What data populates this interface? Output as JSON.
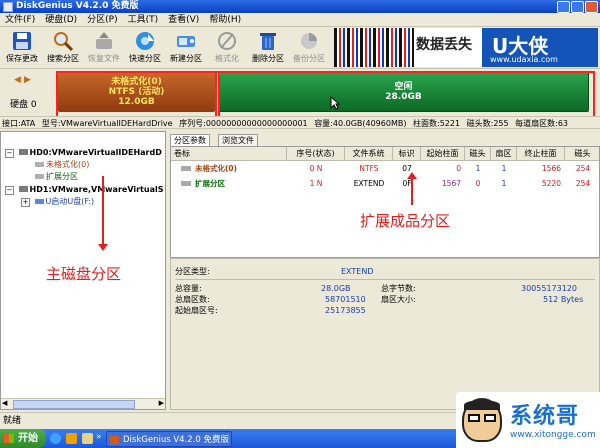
{
  "window": {
    "title": "DiskGenius V4.2.0 免费版"
  },
  "menu": [
    "文件(F)",
    "硬盘(D)",
    "分区(P)",
    "工具(T)",
    "查看(V)",
    "帮助(H)"
  ],
  "toolbar": [
    {
      "label": "保存更改",
      "icon": "save-icon"
    },
    {
      "label": "搜索分区",
      "icon": "magnifier-icon"
    },
    {
      "label": "恢复文件",
      "icon": "restore-icon"
    },
    {
      "label": "快速分区",
      "icon": "quick-partition-icon"
    },
    {
      "label": "新建分区",
      "icon": "new-partition-icon"
    },
    {
      "label": "格式化",
      "icon": "format-icon"
    },
    {
      "label": "删除分区",
      "icon": "trash-icon"
    },
    {
      "label": "备份分区",
      "icon": "backup-icon"
    }
  ],
  "banner": {
    "brand": "U大侠",
    "url": "www.udaxia.com",
    "cn_text": "数据丢失"
  },
  "disk_panel": {
    "label": "硬盘 0"
  },
  "disk_bar": {
    "p1": {
      "name": "未格式化(0)",
      "fs": "NTFS (活动)",
      "size": "12.0GB"
    },
    "p2": {
      "name": "空闲",
      "size": "28.0GB"
    }
  },
  "infoline": {
    "iface": "接口:ATA",
    "model": "型号:VMwareVirtualIDEHardDrive",
    "serial": "序列号:00000000000000000001",
    "capacity": "容量:40.0GB(40960MB)",
    "cylinders": "柱面数:5221",
    "heads": "磁头数:255",
    "sectors": "每道扇区数:63"
  },
  "tree": [
    "HD0:VMwareVirtualIDEHardD",
    "未格式化(0)",
    "扩展分区",
    "HD1:VMware,VMwareVirtualS",
    "U启动U盘(F:)"
  ],
  "tabs": [
    "分区参数",
    "浏览文件"
  ],
  "table": {
    "headers": [
      "卷标",
      "序号(状态)",
      "文件系统",
      "标识",
      "起始柱面",
      "磁头",
      "扇区",
      "终止柱面",
      "磁头"
    ],
    "rows": [
      [
        "未格式化(0)",
        "0 N",
        "NTFS",
        "07",
        "0",
        "1",
        "1",
        "1566",
        "254"
      ],
      [
        "扩展分区",
        "1 N",
        "EXTEND",
        "0F",
        "1567",
        "0",
        "1",
        "5220",
        "254"
      ]
    ]
  },
  "details": {
    "type_label": "分区类型:",
    "type_value": "EXTEND",
    "cap_label": "总容量:",
    "cap_value": "28.0GB",
    "bytes_label": "总字节数:",
    "bytes_value": "30055173120",
    "sect_label": "总扇区数:",
    "sect_value": "58701510",
    "ssize_label": "扇区大小:",
    "ssize_value": "512 Bytes",
    "start_label": "起始扇区号:",
    "start_value": "25173855"
  },
  "annotations": {
    "main": "主磁盘分区",
    "ext": "扩展成品分区"
  },
  "status": "就绪",
  "taskbar": {
    "start": "开始",
    "task": "DiskGenius V4.2.0 免费版"
  },
  "logo": {
    "name": "系统哥",
    "url": "www.xitongge.com"
  },
  "colors": {
    "primary": "#a84818",
    "free": "#1c8a3a",
    "annotation": "#e02020",
    "red_text": "#d02020",
    "extend_text": "#0a6a0a"
  }
}
